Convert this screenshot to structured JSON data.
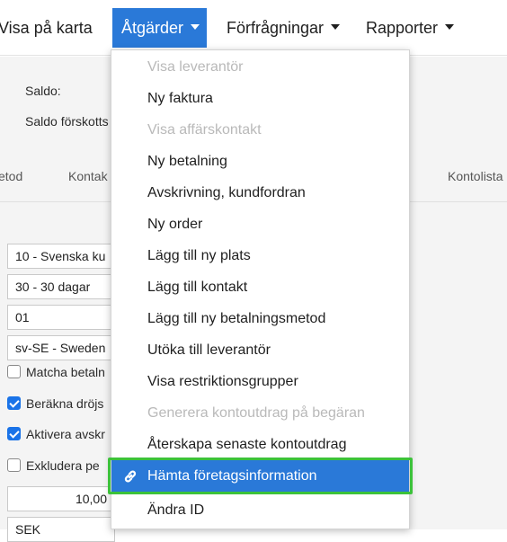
{
  "topbar": {
    "menus": [
      {
        "label": "Visa på karta"
      },
      {
        "label": "Åtgärder"
      },
      {
        "label": "Förfrågningar"
      },
      {
        "label": "Rapporter"
      }
    ]
  },
  "form": {
    "saldo_label": "Saldo:",
    "saldo_forskott_label": "Saldo förskotts",
    "tabs": [
      "etod",
      "Kontak",
      "Kontolista"
    ],
    "fields": [
      "10 - Svenska ku",
      "30 - 30 dagar",
      "01",
      "sv-SE - Sweden"
    ],
    "checkboxes": [
      {
        "label": "Matcha betaln",
        "checked": false
      },
      {
        "label": "Beräkna dröjs",
        "checked": true
      },
      {
        "label": "Aktivera avskr",
        "checked": true
      },
      {
        "label": "Exkludera pe",
        "checked": false
      }
    ],
    "amount": "10,00",
    "currency": "SEK"
  },
  "dropdown": {
    "items": [
      {
        "label": "Visa leverantör",
        "disabled": true
      },
      {
        "label": "Ny faktura",
        "disabled": false
      },
      {
        "label": "Visa affärskontakt",
        "disabled": true
      },
      {
        "label": "Ny betalning",
        "disabled": false
      },
      {
        "label": "Avskrivning, kundfordran",
        "disabled": false
      },
      {
        "label": "Ny order",
        "disabled": false
      },
      {
        "label": "Lägg till ny plats",
        "disabled": false
      },
      {
        "label": "Lägg till kontakt",
        "disabled": false
      },
      {
        "label": "Lägg till ny betalningsmetod",
        "disabled": false
      },
      {
        "label": "Utöka till leverantör",
        "disabled": false
      },
      {
        "label": "Visa restriktionsgrupper",
        "disabled": false
      },
      {
        "label": "Generera kontoutdrag på begäran",
        "disabled": true
      },
      {
        "label": "Återskapa senaste kontoutdrag",
        "disabled": false
      },
      {
        "label": "Hämta företagsinformation",
        "disabled": false,
        "selected": true,
        "icon": "link-icon"
      },
      {
        "label": "Ändra ID",
        "disabled": false
      }
    ]
  },
  "colors": {
    "accent": "#2a79d8",
    "highlight": "#3cc23a",
    "disabled_text": "#b9b9b9"
  }
}
